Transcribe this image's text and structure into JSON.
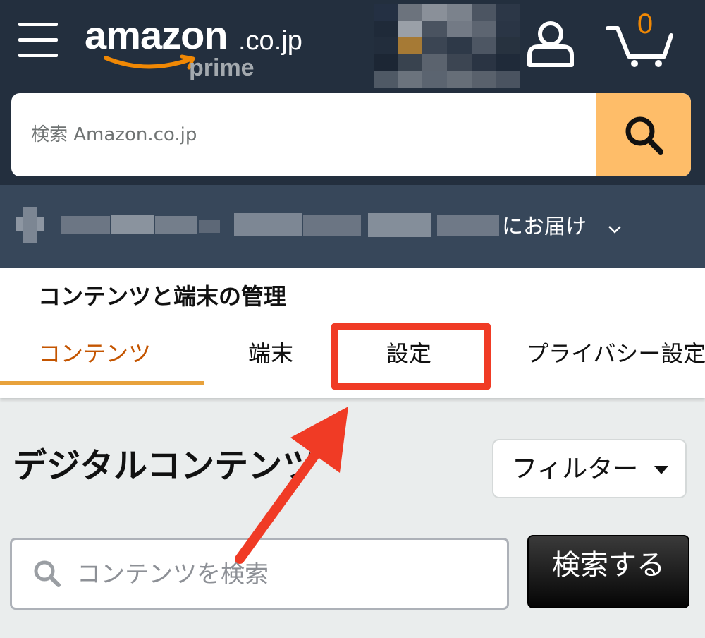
{
  "header": {
    "logo_text": "amazon",
    "logo_domain": ".co.jp",
    "logo_sub": "prime",
    "cart_count": "0",
    "icons": [
      "menu-icon",
      "account-icon",
      "cart-icon",
      "search-icon"
    ],
    "colors": {
      "header_bg": "#232f3e",
      "subheader_bg": "#37475a",
      "search_button": "#febd69",
      "cart_count": "#f08804"
    }
  },
  "search": {
    "placeholder": "検索 Amazon.co.jp"
  },
  "delivery": {
    "label": "にお届け"
  },
  "nav": {
    "title": "コンテンツと端末の管理",
    "tabs": [
      {
        "label": "コンテンツ",
        "active": true
      },
      {
        "label": "端末",
        "active": false
      },
      {
        "label": "設定",
        "active": false,
        "highlighted": true
      },
      {
        "label": "プライバシー設定",
        "active": false
      }
    ],
    "colors": {
      "active_tab": "#c45500",
      "underline": "#e8a23c",
      "highlight": "#f03b25"
    }
  },
  "main": {
    "section_title": "デジタルコンテンツ",
    "filter_label": "フィルター",
    "content_search_placeholder": "コンテンツを検索",
    "search_button_label": "検索する"
  }
}
